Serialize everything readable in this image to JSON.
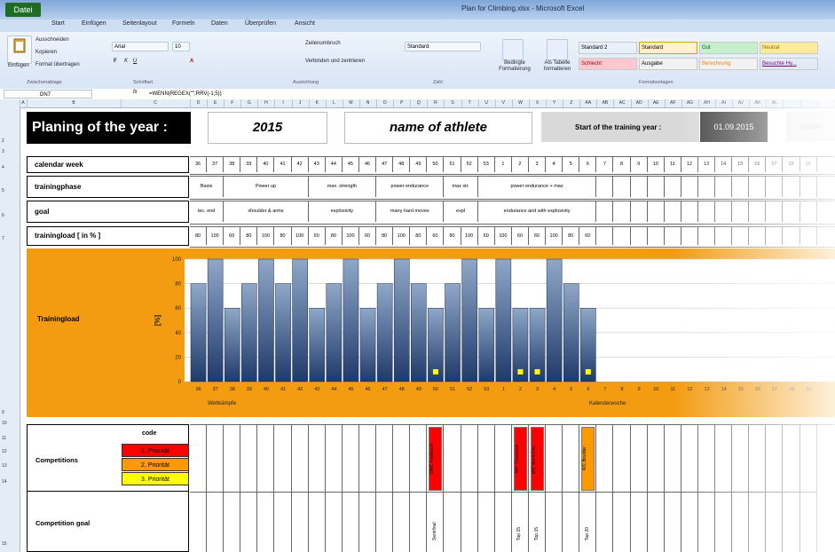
{
  "window": {
    "title": "Plan for Climbing.xlsx - Microsoft Excel",
    "app_menu": "Datei"
  },
  "ribbon": {
    "tabs": [
      "Start",
      "Einfügen",
      "Seitenlayout",
      "Formeln",
      "Daten",
      "Überprüfen",
      "Ansicht"
    ],
    "clipboard": {
      "paste": "Einfügen",
      "cut": "Ausschneiden",
      "copy": "Kopieren",
      "format_painter": "Format übertragen",
      "group": "Zwischenablage"
    },
    "font": {
      "name": "Arial",
      "size": "10",
      "group": "Schriftart"
    },
    "alignment": {
      "wrap": "Zeilenumbruch",
      "merge": "Verbinden und zentrieren",
      "group": "Ausrichtung"
    },
    "number": {
      "format": "Standard",
      "group": "Zahl"
    },
    "styles": {
      "conditional": "Bedingte Formatierung",
      "as_table": "Als Tabelle formatieren",
      "group": "Formatvorlagen",
      "items": [
        {
          "label": "Standard 2",
          "bg": "#ffffff"
        },
        {
          "label": "Standard",
          "bg": "#fff2cc"
        },
        {
          "label": "Gut",
          "bg": "#c6efce"
        },
        {
          "label": "Neutral",
          "bg": "#ffeb9c"
        },
        {
          "label": "Schlecht",
          "bg": "#ffc7ce"
        },
        {
          "label": "Ausgabe",
          "bg": "#f2f2f2"
        },
        {
          "label": "Berechnung",
          "bg": "#f2f2f2"
        },
        {
          "label": "Besuchte Hy...",
          "bg": "#ffffff"
        }
      ]
    }
  },
  "formula_bar": {
    "name_box": "DN7",
    "formula": "=WENN(REGEX(\"\";RRV(-1;5))"
  },
  "sheet": {
    "title": "Planing of the year :",
    "year": "2015",
    "athlete": "name of athlete",
    "start_label": "Start of the training year :",
    "start_date": "01.09.2015",
    "update": "update",
    "rows": {
      "week": "calendar week",
      "phase": "trainingphase",
      "goal": "goal",
      "load": "trainingload [ in % ]"
    },
    "weeks": [
      "36",
      "37",
      "38",
      "39",
      "40",
      "41",
      "42",
      "43",
      "44",
      "45",
      "46",
      "47",
      "48",
      "49",
      "50",
      "51",
      "52",
      "53",
      "1",
      "2",
      "3",
      "4",
      "5",
      "6",
      "7",
      "8",
      "9",
      "10",
      "11",
      "12",
      "13",
      "14",
      "15",
      "16",
      "17",
      "18",
      "19"
    ],
    "phases": [
      "Basis",
      "Power up",
      "max. strength",
      "power endurance",
      "max str.",
      "power endurance + max"
    ],
    "goals": [
      "tec. end",
      "shoulder & arms",
      "explosivity",
      "many hard moves",
      "expl",
      "endurance and with explosivity"
    ],
    "loads": [
      "80",
      "100",
      "60",
      "80",
      "100",
      "80",
      "100",
      "60",
      "80",
      "100",
      "60",
      "80",
      "100",
      "80",
      "60",
      "80",
      "100",
      "60",
      "100",
      "60",
      "60",
      "100",
      "80",
      "60"
    ],
    "chart_label": "Trainingload",
    "competitions_label": "Competitions",
    "competition_goal_label": "Competition goal",
    "code_label": "code",
    "priorities": [
      {
        "label": "1. Priorität",
        "color": "#ff0000"
      },
      {
        "label": "2. Priorität",
        "color": "#ff9900"
      },
      {
        "label": "3. Priorität",
        "color": "#ffff00"
      }
    ],
    "competitions": [
      {
        "week": "50",
        "name": "DMC Innsbruck",
        "color": "#ff0000",
        "goal": "Semifinal"
      },
      {
        "week": "2",
        "name": "WC Chamonix",
        "color": "#ff0000",
        "goal": "Top 15"
      },
      {
        "week": "3",
        "name": "WC Saint Ges.",
        "color": "#ff0000",
        "goal": "Top 15"
      },
      {
        "week": "6",
        "name": "WC Boulder",
        "color": "#ff9900",
        "goal": "Top 20"
      }
    ]
  },
  "chart_data": {
    "type": "bar",
    "title": "",
    "xlabel": "Wettkämpfe",
    "xlabel2": "Kalenderwoche",
    "ylabel": "[%]",
    "ylim": [
      0,
      100
    ],
    "yticks": [
      "0",
      "20",
      "40",
      "60",
      "80",
      "100"
    ],
    "categories": [
      "36",
      "37",
      "38",
      "39",
      "40",
      "41",
      "42",
      "43",
      "44",
      "45",
      "46",
      "47",
      "48",
      "49",
      "50",
      "51",
      "52",
      "53",
      "1",
      "2",
      "3",
      "4",
      "5",
      "6",
      "7",
      "8",
      "9",
      "10",
      "11",
      "12",
      "13",
      "14",
      "15",
      "16",
      "17",
      "18",
      "19"
    ],
    "values": [
      80,
      100,
      60,
      80,
      100,
      80,
      100,
      60,
      80,
      100,
      60,
      80,
      100,
      80,
      60,
      80,
      100,
      60,
      100,
      60,
      60,
      100,
      80,
      60
    ],
    "markers": [
      {
        "week": "50",
        "value": 8
      },
      {
        "week": "2",
        "value": 8
      },
      {
        "week": "3",
        "value": 8
      },
      {
        "week": "6",
        "value": 8
      }
    ],
    "bar_color_top": "#8fa8c8",
    "bar_color_bottom": "#1f3a6a",
    "marker_color": "#ffff00"
  }
}
